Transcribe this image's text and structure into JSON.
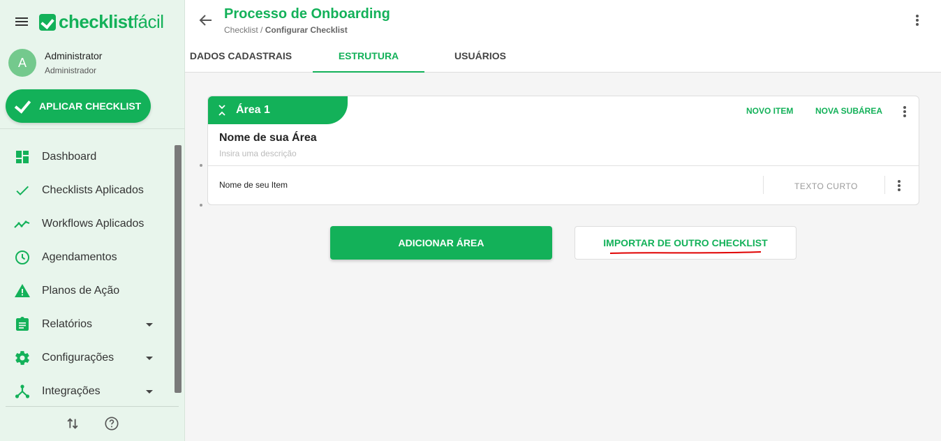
{
  "sidebar": {
    "logo": {
      "bold": "checklist",
      "light": "fácil"
    },
    "user": {
      "initial": "A",
      "name": "Administrator",
      "role": "Administrador"
    },
    "apply_button": "APLICAR CHECKLIST",
    "items": [
      {
        "label": "Dashboard",
        "icon": "dashboard-icon"
      },
      {
        "label": "Checklists Aplicados",
        "icon": "check-icon"
      },
      {
        "label": "Workflows Aplicados",
        "icon": "trending-icon"
      },
      {
        "label": "Agendamentos",
        "icon": "clock-icon"
      },
      {
        "label": "Planos de Ação",
        "icon": "warning-icon"
      },
      {
        "label": "Relatórios",
        "icon": "clipboard-icon",
        "expandable": true
      },
      {
        "label": "Configurações",
        "icon": "gear-icon",
        "expandable": true
      },
      {
        "label": "Integrações",
        "icon": "integration-icon",
        "expandable": true
      }
    ]
  },
  "header": {
    "title": "Processo de Onboarding",
    "breadcrumb_root": "Checklist",
    "breadcrumb_sep": " / ",
    "breadcrumb_current": "Configurar Checklist",
    "tabs": [
      {
        "label": "DADOS CADASTRAIS",
        "active": false
      },
      {
        "label": "ESTRUTURA",
        "active": true
      },
      {
        "label": "USUÁRIOS",
        "active": false
      }
    ]
  },
  "area": {
    "tab_label": "Área 1",
    "new_item": "NOVO ITEM",
    "new_subarea": "NOVA SUBÁREA",
    "name": "Nome de sua Área",
    "description_placeholder": "Insira uma descrição",
    "item": {
      "name": "Nome de seu Item",
      "type": "TEXTO CURTO"
    }
  },
  "actions": {
    "add_area": "ADICIONAR ÁREA",
    "import": "IMPORTAR DE OUTRO CHECKLIST"
  },
  "colors": {
    "brand_green": "#13b159",
    "sidebar_bg": "#e8f5ec",
    "annotation_red": "#e00000"
  }
}
